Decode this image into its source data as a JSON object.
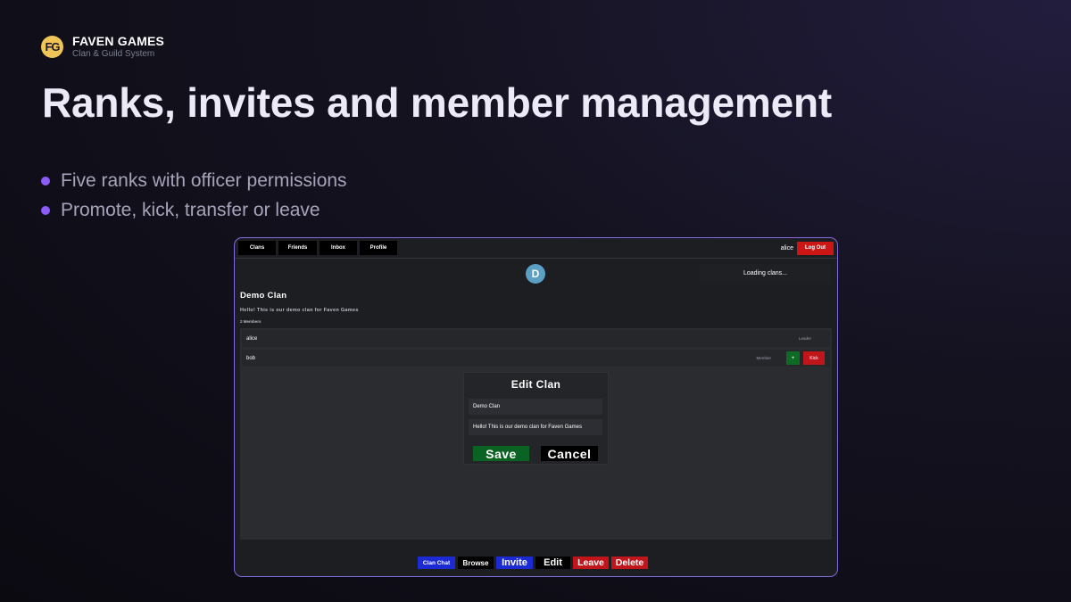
{
  "brand": {
    "logo_text": "FG",
    "name": "FAVEN GAMES",
    "subtitle": "Clan & Guild System",
    "logo_color": "#f0c456"
  },
  "headline": "Ranks, invites and member management",
  "bullets": [
    "Five ranks with officer permissions",
    "Promote, kick, transfer or leave"
  ],
  "accent_color": "#8b5cf6",
  "app": {
    "nav": {
      "clans": "Clans",
      "friends": "Friends",
      "inbox": "Inbox",
      "profile": "Profile"
    },
    "user": {
      "name": "alice",
      "logout": "Log Out"
    },
    "avatar_letter": "D",
    "loading_text": "Loading clans...",
    "clan": {
      "name": "Demo Clan",
      "description": "Hello! This is our demo clan for Faven Games",
      "member_count": "2 Members"
    },
    "members": [
      {
        "name": "alice",
        "rank": "Leader"
      },
      {
        "name": "bob",
        "rank": "Member",
        "promote_label": "+",
        "kick_label": "Kick"
      }
    ],
    "edit_modal": {
      "title": "Edit Clan",
      "name_value": "Demo Clan",
      "description_value": "Hello! This is our demo clan for Faven Games",
      "save": "Save",
      "cancel": "Cancel"
    },
    "actions": {
      "clan_chat": "Clan Chat",
      "browse": "Browse",
      "invite": "Invite",
      "edit": "Edit",
      "leave": "Leave",
      "delete": "Delete"
    },
    "colors": {
      "danger": "#c0161b",
      "success": "#0b6323",
      "primary": "#1b2ad2",
      "border": "#7f6bdb"
    }
  }
}
